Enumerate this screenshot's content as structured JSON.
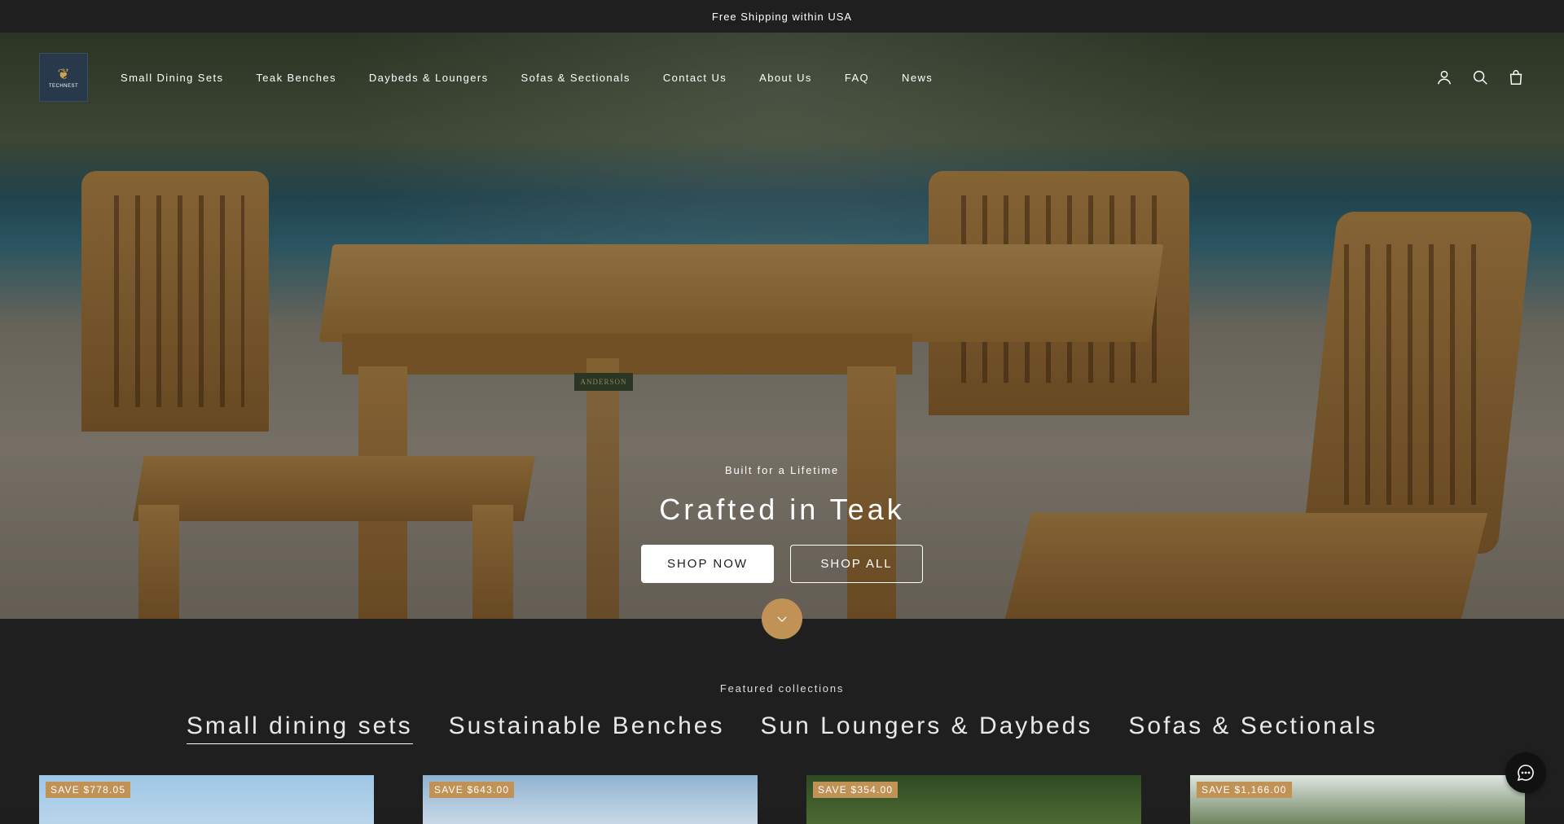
{
  "announcement": {
    "text": "Free Shipping within USA"
  },
  "header": {
    "logo_text": "TECHNEST",
    "nav": [
      "Small Dining Sets",
      "Teak Benches",
      "Daybeds & Loungers",
      "Sofas & Sectionals",
      "Contact Us",
      "About Us",
      "FAQ",
      "News"
    ],
    "icons": [
      "account-icon",
      "search-icon",
      "cart-icon"
    ]
  },
  "hero": {
    "eyebrow": "Built for a Lifetime",
    "title": "Crafted in Teak",
    "primary_cta": "SHOP NOW",
    "secondary_cta": "SHOP ALL",
    "table_plaque": "ANDERSON"
  },
  "featured": {
    "label": "Featured collections",
    "tabs": [
      "Small dining sets",
      "Sustainable Benches",
      "Sun Loungers & Daybeds",
      "Sofas & Sectionals"
    ],
    "active_tab": "Small dining sets",
    "cards": [
      {
        "badge": "SAVE $778.05"
      },
      {
        "badge": "SAVE $643.00"
      },
      {
        "badge": "SAVE $354.00"
      },
      {
        "badge": "SAVE $1,166.00"
      }
    ]
  },
  "colors": {
    "accent": "#c19256",
    "bar": "#1f1f1f"
  }
}
